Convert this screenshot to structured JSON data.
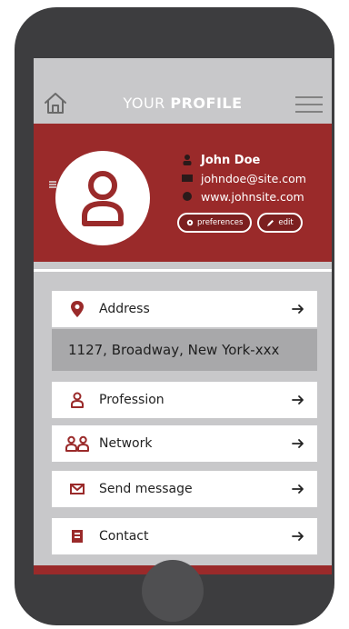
{
  "header": {
    "title_light": "YOUR ",
    "title_bold": "PROFILE"
  },
  "profile": {
    "name": "John Doe",
    "email": "johndoe@site.com",
    "website": "www.johnsite.com",
    "preferences_label": "preferences",
    "edit_label": "edit"
  },
  "menu": {
    "address_label": "Address",
    "address_value": "1127, Broadway, New York-xxx",
    "profession_label": "Profession",
    "network_label": "Network",
    "send_message_label": "Send message",
    "contact_label": "Contact"
  },
  "colors": {
    "accent": "#9a2a2a",
    "screen_bg": "#c8c8ca",
    "phone_body": "#3d3d3f"
  }
}
